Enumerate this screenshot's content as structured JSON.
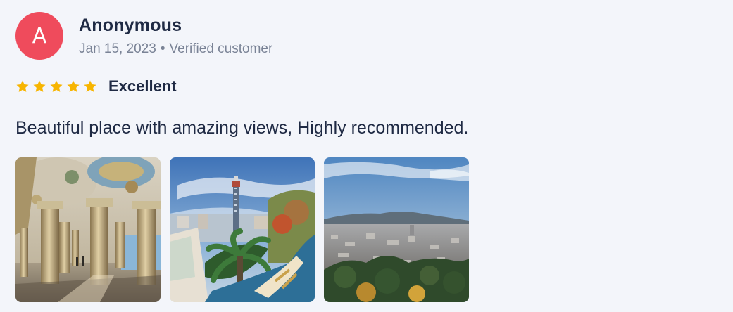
{
  "review": {
    "avatar_initial": "A",
    "author": "Anonymous",
    "date": "Jan 15, 2023",
    "separator": "•",
    "badge": "Verified customer",
    "rating": 5,
    "rating_max": 5,
    "rating_label": "Excellent",
    "text": "Beautiful place with amazing views, Highly recommended."
  },
  "photos": [
    {
      "icon": "photo-colonnade"
    },
    {
      "icon": "photo-tower-view"
    },
    {
      "icon": "photo-city-panorama"
    }
  ],
  "colors": {
    "background": "#f3f5fa",
    "avatar": "#ef4b5c",
    "star": "#f7b500",
    "text": "#1f2a44",
    "muted": "#7a8396"
  }
}
